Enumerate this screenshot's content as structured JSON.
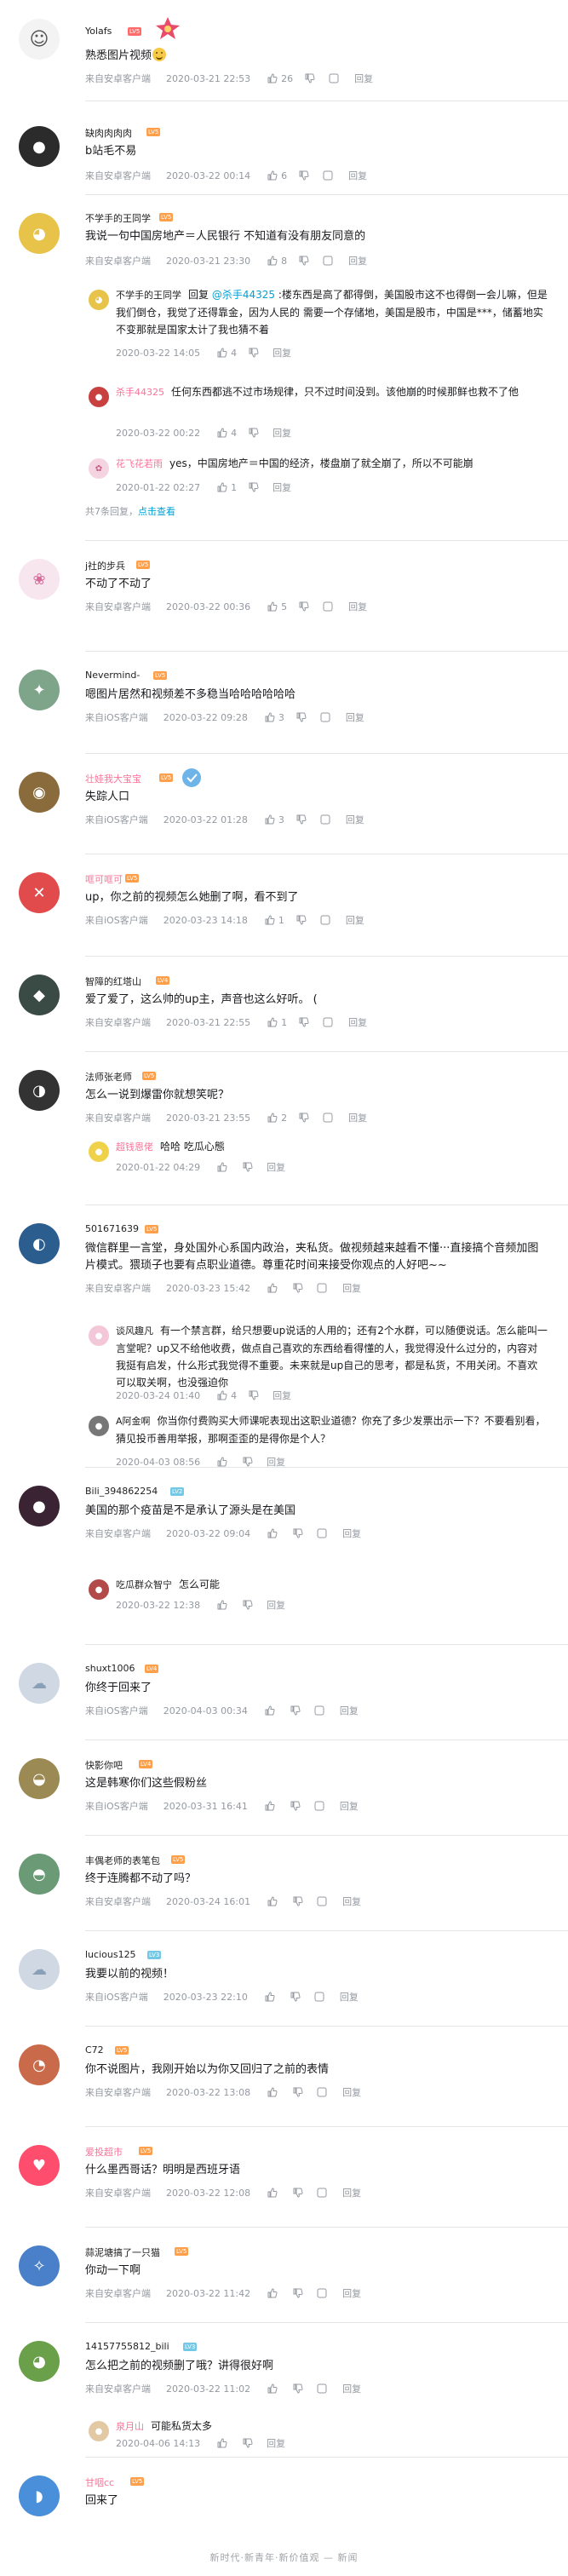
{
  "icons": {
    "like": "thumbs-up-icon",
    "dislike": "thumbs-down-icon",
    "share": "share-icon",
    "reply": "reply-label"
  },
  "reply_label": "回复",
  "comments": [
    {
      "user": "Yolafs",
      "level": "LV5",
      "text": "熟悉图片视频",
      "source": "来自安卓客户端",
      "time": "2020-03-21 22:53",
      "likes": "26"
    },
    {
      "user": "缺肉肉肉肉",
      "level": "LV5",
      "text": "b站毛不易",
      "source": "来自安卓客户端",
      "time": "2020-03-22 00:14",
      "likes": "6"
    },
    {
      "user": "不学手的王同学",
      "level": "LV5",
      "text": "我说一句中国房地产＝人民银行 不知道有没有朋友同意的",
      "source": "来自安卓客户端",
      "time": "2020-03-21 23:30",
      "likes": "8",
      "replies": [
        {
          "user": "不学手的王同学",
          "text_prefix": "回复 ",
          "mention": "@杀手44325",
          "text": " :楼东西是高了都得倒，美国股市这不也得倒一会儿嘛，但是我们倒仓，我觉了还得靠金，因为人民的 需要一个存储地，美国是股市，中国是***，储蓄地实不变那就是国家太计了我也猜不着",
          "time": "2020-03-22 14:05",
          "likes": "4"
        },
        {
          "user": "杀手44325",
          "text": "任何东西都逃不过市场规律，只不过时间没到。该他崩的时候那鲜也救不了他",
          "time": "2020-03-22 00:22",
          "likes": "4"
        },
        {
          "user": "花飞花若雨",
          "text": "yes，中国房地产＝中国的经济，楼盘崩了就全崩了，所以不可能崩",
          "time": "2020-01-22 02:27",
          "likes": "1"
        }
      ],
      "more_prefix": "共7条回复，",
      "more_link": "点击查看"
    },
    {
      "user": "j社的步兵",
      "level": "LV5",
      "text": "不动了不动了",
      "source": "来自安卓客户端",
      "time": "2020-03-22 00:36",
      "likes": "5"
    },
    {
      "user": "Nevermind-",
      "level": "LV5",
      "text": "嗯图片居然和视频差不多稳当哈哈哈哈哈哈",
      "source": "来自iOS客户端",
      "time": "2020-03-22 09:28",
      "likes": "3"
    },
    {
      "user": "壮娃我大宝宝",
      "level": "LV5",
      "text": "失踪人口",
      "source": "来自iOS客户端",
      "time": "2020-03-22 01:28",
      "likes": "3"
    },
    {
      "user": "哐可哐可",
      "level": "LV5",
      "text": "up，你之前的视频怎么她删了啊，看不到了",
      "source": "来自iOS客户端",
      "time": "2020-03-23 14:18",
      "likes": "1"
    },
    {
      "user": "智障的红塔山",
      "level": "LV4",
      "text": "爱了爱了，这么帅的up主，声音也这么好听。 (",
      "source": "来自安卓客户端",
      "time": "2020-03-21 22:55",
      "likes": "1"
    },
    {
      "user": "法师张老师",
      "level": "LV5",
      "text": "怎么一说到爆雷你就想笑呢？",
      "source": "来自安卓客户端",
      "time": "2020-03-21 23:55",
      "likes": "2",
      "replies": [
        {
          "user": "超钱恩佬",
          "text": "哈哈 吃瓜心態",
          "time": "2020-01-22 04:29",
          "likes": ""
        }
      ]
    },
    {
      "user": "501671639",
      "level": "LV5",
      "text": "微信群里一言堂，身处国外心系国内政治，夹私货。做视频越来越看不懂···直接搞个音频加图片模式。猥琐子也要有点职业道德。尊重花时间来接受你观点的人好吧~~",
      "source": "来自安卓客户端",
      "time": "2020-03-23 15:42",
      "likes": "",
      "replies": [
        {
          "user": "谈风趣凡",
          "text": "有一个禁言群，给只想要up说话的人用的；还有2个水群，可以随便说话。怎么能叫一言堂呢？up又不给他收费，做点自己喜欢的东西给看得懂的人，我觉得没什么过分的，内容对我挺有启发，什么形式我觉得不重要。未来就是up自己的思考，都是私货，不用关闭。不喜欢可以取关啊，也没强迫你",
          "time": "2020-03-24 01:40",
          "likes": "4"
        },
        {
          "user": "A阿金啊",
          "text": "你当你付费购买大师课呢表现出这职业道德？你充了多少发票出示一下？不要看别看，猜见投币善用举报，那啊歪歪的是得你是个人？",
          "time": "2020-04-03 08:56",
          "likes": ""
        }
      ]
    },
    {
      "user": "Bili_394862254",
      "level": "LV2",
      "text": "美国的那个疫苗是不是承认了源头是在美国",
      "source": "来自安卓客户端",
      "time": "2020-03-22 09:04",
      "likes": "",
      "replies": [
        {
          "user": "吃瓜群众智宁",
          "text": "怎么可能",
          "time": "2020-03-22 12:38",
          "likes": ""
        }
      ]
    },
    {
      "user": "shuxt1006",
      "level": "LV4",
      "text": "你终于回来了",
      "source": "来自iOS客户端",
      "time": "2020-04-03 00:34",
      "likes": ""
    },
    {
      "user": "快影你吧",
      "level": "LV4",
      "text": "这是韩寒你们这些假粉丝",
      "source": "来自iOS客户端",
      "time": "2020-03-31 16:41",
      "likes": ""
    },
    {
      "user": "丰偶老师的表笔包",
      "level": "LV5",
      "text": "终于连腾都不动了吗？",
      "source": "来自安卓客户端",
      "time": "2020-03-24 16:01",
      "likes": ""
    },
    {
      "user": "lucious125",
      "level": "LV3",
      "text": "我要以前的视频！",
      "source": "来自iOS客户端",
      "time": "2020-03-23 22:10",
      "likes": ""
    },
    {
      "user": "C72",
      "level": "LV5",
      "text": "你不说图片，我刚开始以为你又回归了之前的表情",
      "source": "来自安卓客户端",
      "time": "2020-03-22 13:08",
      "likes": ""
    },
    {
      "user": "爱投超市",
      "level": "LV5",
      "text": "什么墨西哥话？明明是西班牙语",
      "source": "来自安卓客户端",
      "time": "2020-03-22 12:08",
      "likes": ""
    },
    {
      "user": "蒜泥塘搞了一只猫",
      "level": "LV5",
      "text": "你动一下啊",
      "source": "来自安卓客户端",
      "time": "2020-03-22 11:42",
      "likes": ""
    },
    {
      "user": "14157755812_bili",
      "level": "LV3",
      "text": "怎么把之前的视频删了哦？讲得很好啊",
      "source": "来自安卓客户端",
      "time": "2020-03-22 11:02",
      "likes": "",
      "replies": [
        {
          "user": "泉月山",
          "text": "可能私货太多",
          "time": "2020-04-06 14:13",
          "likes": ""
        }
      ]
    },
    {
      "user": "甘咽cc",
      "level": "LV5",
      "text": "回来了",
      "source": "",
      "time": "",
      "likes": ""
    }
  ],
  "footer_text": "新时代·新青年·新价值观 — 新闻",
  "colors": {
    "accent": "#00a1d6",
    "pink": "#fb7299",
    "meta": "#9499a0",
    "divider": "#e3e5e7"
  }
}
